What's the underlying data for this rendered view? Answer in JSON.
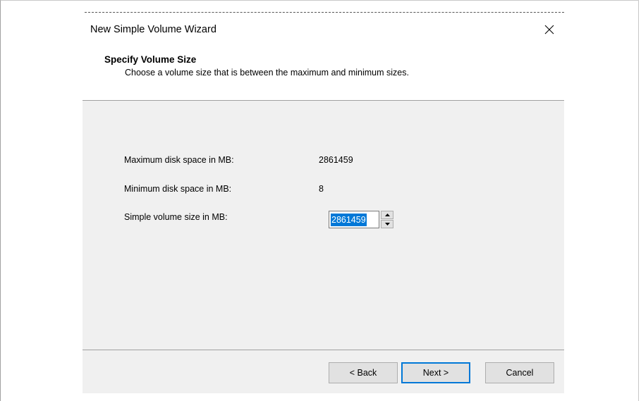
{
  "window": {
    "title": "New Simple Volume Wizard"
  },
  "header": {
    "title": "Specify Volume Size",
    "subtitle": "Choose a volume size that is between the maximum and minimum sizes."
  },
  "fields": {
    "max_label": "Maximum disk space in MB:",
    "max_value": "2861459",
    "min_label": "Minimum disk space in MB:",
    "min_value": "8",
    "size_label": "Simple volume size in MB:",
    "size_value": "2861459"
  },
  "buttons": {
    "back": "< Back",
    "next": "Next >",
    "cancel": "Cancel"
  },
  "icons": {
    "close": "close-icon",
    "spin_up": "chevron-up-icon",
    "spin_down": "chevron-down-icon"
  },
  "colors": {
    "accent": "#0078d7",
    "content_bg": "#f0f0f0"
  }
}
